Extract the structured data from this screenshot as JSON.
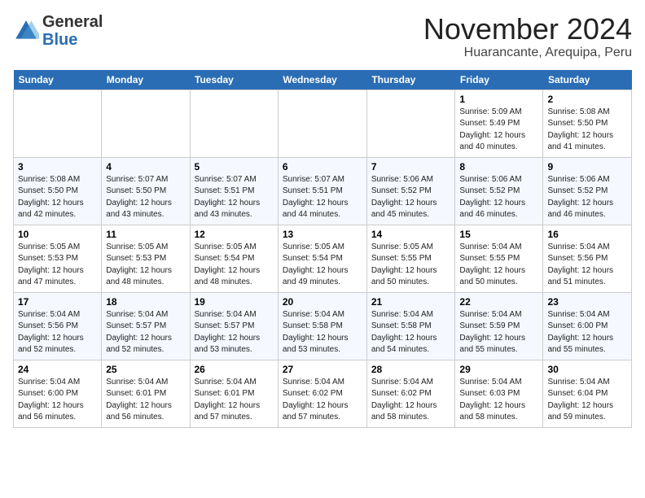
{
  "header": {
    "logo": {
      "general": "General",
      "blue": "Blue"
    },
    "title": "November 2024",
    "location": "Huarancante, Arequipa, Peru"
  },
  "weekdays": [
    "Sunday",
    "Monday",
    "Tuesday",
    "Wednesday",
    "Thursday",
    "Friday",
    "Saturday"
  ],
  "weeks": [
    [
      {
        "day": "",
        "info": ""
      },
      {
        "day": "",
        "info": ""
      },
      {
        "day": "",
        "info": ""
      },
      {
        "day": "",
        "info": ""
      },
      {
        "day": "",
        "info": ""
      },
      {
        "day": "1",
        "info": "Sunrise: 5:09 AM\nSunset: 5:49 PM\nDaylight: 12 hours\nand 40 minutes."
      },
      {
        "day": "2",
        "info": "Sunrise: 5:08 AM\nSunset: 5:50 PM\nDaylight: 12 hours\nand 41 minutes."
      }
    ],
    [
      {
        "day": "3",
        "info": "Sunrise: 5:08 AM\nSunset: 5:50 PM\nDaylight: 12 hours\nand 42 minutes."
      },
      {
        "day": "4",
        "info": "Sunrise: 5:07 AM\nSunset: 5:50 PM\nDaylight: 12 hours\nand 43 minutes."
      },
      {
        "day": "5",
        "info": "Sunrise: 5:07 AM\nSunset: 5:51 PM\nDaylight: 12 hours\nand 43 minutes."
      },
      {
        "day": "6",
        "info": "Sunrise: 5:07 AM\nSunset: 5:51 PM\nDaylight: 12 hours\nand 44 minutes."
      },
      {
        "day": "7",
        "info": "Sunrise: 5:06 AM\nSunset: 5:52 PM\nDaylight: 12 hours\nand 45 minutes."
      },
      {
        "day": "8",
        "info": "Sunrise: 5:06 AM\nSunset: 5:52 PM\nDaylight: 12 hours\nand 46 minutes."
      },
      {
        "day": "9",
        "info": "Sunrise: 5:06 AM\nSunset: 5:52 PM\nDaylight: 12 hours\nand 46 minutes."
      }
    ],
    [
      {
        "day": "10",
        "info": "Sunrise: 5:05 AM\nSunset: 5:53 PM\nDaylight: 12 hours\nand 47 minutes."
      },
      {
        "day": "11",
        "info": "Sunrise: 5:05 AM\nSunset: 5:53 PM\nDaylight: 12 hours\nand 48 minutes."
      },
      {
        "day": "12",
        "info": "Sunrise: 5:05 AM\nSunset: 5:54 PM\nDaylight: 12 hours\nand 48 minutes."
      },
      {
        "day": "13",
        "info": "Sunrise: 5:05 AM\nSunset: 5:54 PM\nDaylight: 12 hours\nand 49 minutes."
      },
      {
        "day": "14",
        "info": "Sunrise: 5:05 AM\nSunset: 5:55 PM\nDaylight: 12 hours\nand 50 minutes."
      },
      {
        "day": "15",
        "info": "Sunrise: 5:04 AM\nSunset: 5:55 PM\nDaylight: 12 hours\nand 50 minutes."
      },
      {
        "day": "16",
        "info": "Sunrise: 5:04 AM\nSunset: 5:56 PM\nDaylight: 12 hours\nand 51 minutes."
      }
    ],
    [
      {
        "day": "17",
        "info": "Sunrise: 5:04 AM\nSunset: 5:56 PM\nDaylight: 12 hours\nand 52 minutes."
      },
      {
        "day": "18",
        "info": "Sunrise: 5:04 AM\nSunset: 5:57 PM\nDaylight: 12 hours\nand 52 minutes."
      },
      {
        "day": "19",
        "info": "Sunrise: 5:04 AM\nSunset: 5:57 PM\nDaylight: 12 hours\nand 53 minutes."
      },
      {
        "day": "20",
        "info": "Sunrise: 5:04 AM\nSunset: 5:58 PM\nDaylight: 12 hours\nand 53 minutes."
      },
      {
        "day": "21",
        "info": "Sunrise: 5:04 AM\nSunset: 5:58 PM\nDaylight: 12 hours\nand 54 minutes."
      },
      {
        "day": "22",
        "info": "Sunrise: 5:04 AM\nSunset: 5:59 PM\nDaylight: 12 hours\nand 55 minutes."
      },
      {
        "day": "23",
        "info": "Sunrise: 5:04 AM\nSunset: 6:00 PM\nDaylight: 12 hours\nand 55 minutes."
      }
    ],
    [
      {
        "day": "24",
        "info": "Sunrise: 5:04 AM\nSunset: 6:00 PM\nDaylight: 12 hours\nand 56 minutes."
      },
      {
        "day": "25",
        "info": "Sunrise: 5:04 AM\nSunset: 6:01 PM\nDaylight: 12 hours\nand 56 minutes."
      },
      {
        "day": "26",
        "info": "Sunrise: 5:04 AM\nSunset: 6:01 PM\nDaylight: 12 hours\nand 57 minutes."
      },
      {
        "day": "27",
        "info": "Sunrise: 5:04 AM\nSunset: 6:02 PM\nDaylight: 12 hours\nand 57 minutes."
      },
      {
        "day": "28",
        "info": "Sunrise: 5:04 AM\nSunset: 6:02 PM\nDaylight: 12 hours\nand 58 minutes."
      },
      {
        "day": "29",
        "info": "Sunrise: 5:04 AM\nSunset: 6:03 PM\nDaylight: 12 hours\nand 58 minutes."
      },
      {
        "day": "30",
        "info": "Sunrise: 5:04 AM\nSunset: 6:04 PM\nDaylight: 12 hours\nand 59 minutes."
      }
    ]
  ]
}
